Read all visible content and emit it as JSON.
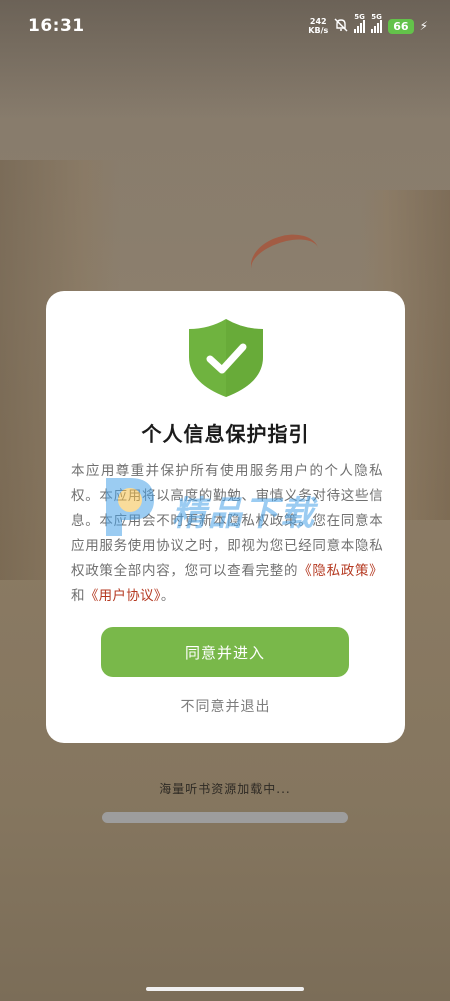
{
  "status_bar": {
    "time": "16:31",
    "net_speed_value": "242",
    "net_speed_unit": "KB/s",
    "signal1_label": "5G",
    "signal2_label": "5G",
    "battery": "66"
  },
  "dialog": {
    "title": "个人信息保护指引",
    "body_text": "本应用尊重并保护所有使用服务用户的个人隐私权。本应用将以高度的勤勉、审慎义务对待这些信息。本应用会不时更新本隐私权政策。您在同意本应用服务使用协议之时，即视为您已经同意本隐私权政策全部内容，您可以查看完整的",
    "privacy_link": "《隐私政策》",
    "conjunction": "和",
    "user_agreement_link": "《用户协议》",
    "ending": "。",
    "agree_button": "同意并进入",
    "disagree_button": "不同意并退出"
  },
  "watermark": {
    "text": "精品下载"
  },
  "loading": {
    "text": "海量听书资源加载中...",
    "progress": 0
  },
  "colors": {
    "accent_green": "#79b84a",
    "link_red": "#b53a22",
    "shield_green": "#6fb33f"
  }
}
